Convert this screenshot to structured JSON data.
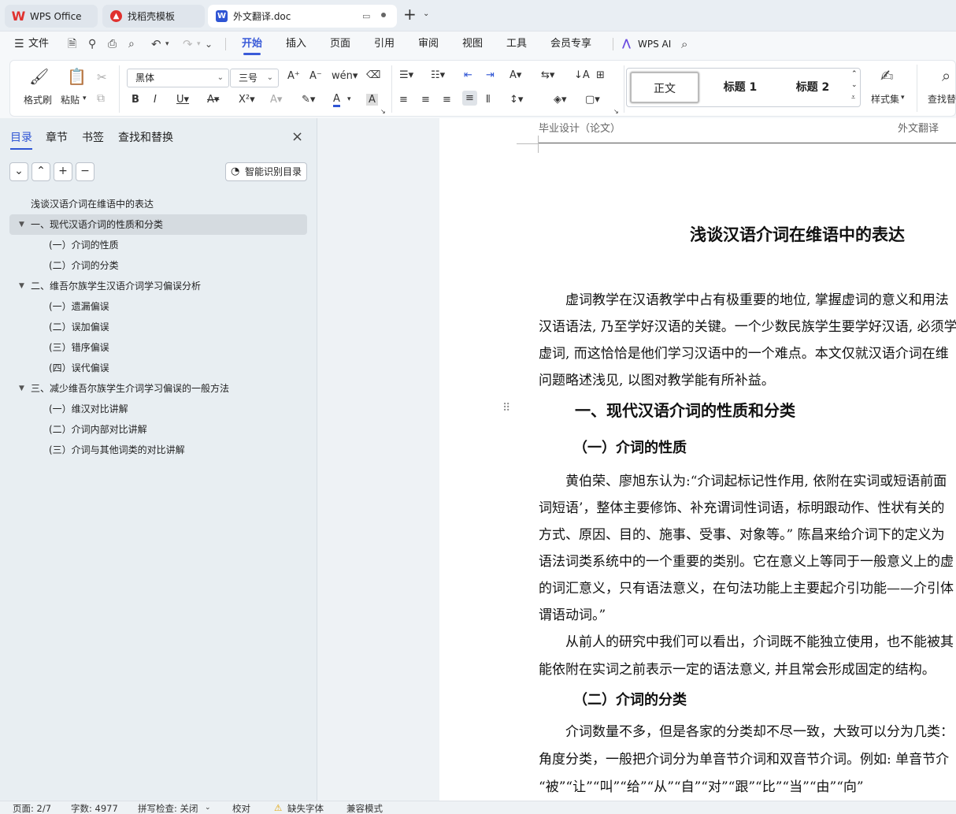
{
  "tabs": {
    "wps_office": "WPS Office",
    "template": "找稻壳模板",
    "doc": "外文翻译.doc",
    "new_tab": "+"
  },
  "menu": {
    "file": "文件",
    "items": [
      "开始",
      "插入",
      "页面",
      "引用",
      "审阅",
      "视图",
      "工具",
      "会员专享"
    ],
    "wps_ai": "WPS AI"
  },
  "ribbon": {
    "format_painter": "格式刷",
    "paste": "粘贴",
    "font_name": "黑体",
    "font_size": "三号",
    "style_normal": "正文",
    "style_h1": "标题 1",
    "style_h2": "标题 2",
    "style_set": "样式集",
    "find_replace": "查找替"
  },
  "sidebar": {
    "tabs": [
      "目录",
      "章节",
      "书签",
      "查找和替换"
    ],
    "smart_toc": "智能识别目录",
    "toc": [
      {
        "label": "浅谈汉语介词在维语中的表达",
        "level": 0,
        "toggle": false
      },
      {
        "label": "一、现代汉语介词的性质和分类",
        "level": 0,
        "toggle": true
      },
      {
        "label": "(一）介词的性质",
        "level": 1,
        "toggle": false
      },
      {
        "label": "(二）介词的分类",
        "level": 1,
        "toggle": false
      },
      {
        "label": "二、维吾尔族学生汉语介词学习偏误分析",
        "level": 0,
        "toggle": true
      },
      {
        "label": "(一）遗漏偏误",
        "level": 1,
        "toggle": false
      },
      {
        "label": "(二）误加偏误",
        "level": 1,
        "toggle": false
      },
      {
        "label": "(三）错序偏误",
        "level": 1,
        "toggle": false
      },
      {
        "label": "(四）误代偏误",
        "level": 1,
        "toggle": false
      },
      {
        "label": "三、减少维吾尔族学生介词学习偏误的一般方法",
        "level": 0,
        "toggle": true
      },
      {
        "label": "(一）维汉对比讲解",
        "level": 1,
        "toggle": false
      },
      {
        "label": "(二）介词内部对比讲解",
        "level": 1,
        "toggle": false
      },
      {
        "label": "(三）介词与其他词类的对比讲解",
        "level": 1,
        "toggle": false
      }
    ]
  },
  "document": {
    "header_left": "毕业设计（论文）",
    "header_right": "外文翻译",
    "title": "浅谈汉语介词在维语中的表达",
    "intro": [
      "虚词教学在汉语教学中占有极重要的地位, 掌握虚词的意义和用法",
      "汉语语法, 乃至学好汉语的关键。一个少数民族学生要学好汉语, 必须学",
      "虚词, 而这恰恰是他们学习汉语中的一个难点。本文仅就汉语介词在维",
      "问题略述浅见, 以图对教学能有所补益。"
    ],
    "h1": "一、现代汉语介词的性质和分类",
    "h2a": "（一）介词的性质",
    "para_a": [
      "黄伯荣、廖旭东认为:“介词起标记性作用, 依附在实词或短语前面",
      "词短语’，整体主要修饰、补充谓词性词语，标明跟动作、性状有关的",
      "方式、原因、目的、施事、受事、对象等。” 陈昌来给介词下的定义为",
      "语法词类系统中的一个重要的类别。它在意义上等同于一般意义上的虚",
      "的词汇意义，只有语法意义，在句法功能上主要起介引功能——介引体",
      "谓语动词。”"
    ],
    "para_b": [
      "从前人的研究中我们可以看出，介词既不能独立使用，也不能被其",
      "能依附在实词之前表示一定的语法意义, 并且常会形成固定的结构。"
    ],
    "h2b": "（二）介词的分类",
    "para_c": [
      "介词数量不多，但是各家的分类却不尽一致，大致可以分为几类：",
      "角度分类，一般把介词分为单音节介词和双音节介词。例如: 单音节介",
      "“被”“让”“叫”“给”“从”“自”“对”“跟”“比”“当”“由”“向”"
    ]
  },
  "status": {
    "page": "页面: 2/7",
    "words": "字数: 4977",
    "spell": "拼写检查: 关闭",
    "proof": "校对",
    "missing_font": "缺失字体",
    "compat": "兼容模式"
  },
  "colors": {
    "accent": "#3a5bd8",
    "wps_red": "#e0312e",
    "doc_blue": "#2f55d4"
  }
}
